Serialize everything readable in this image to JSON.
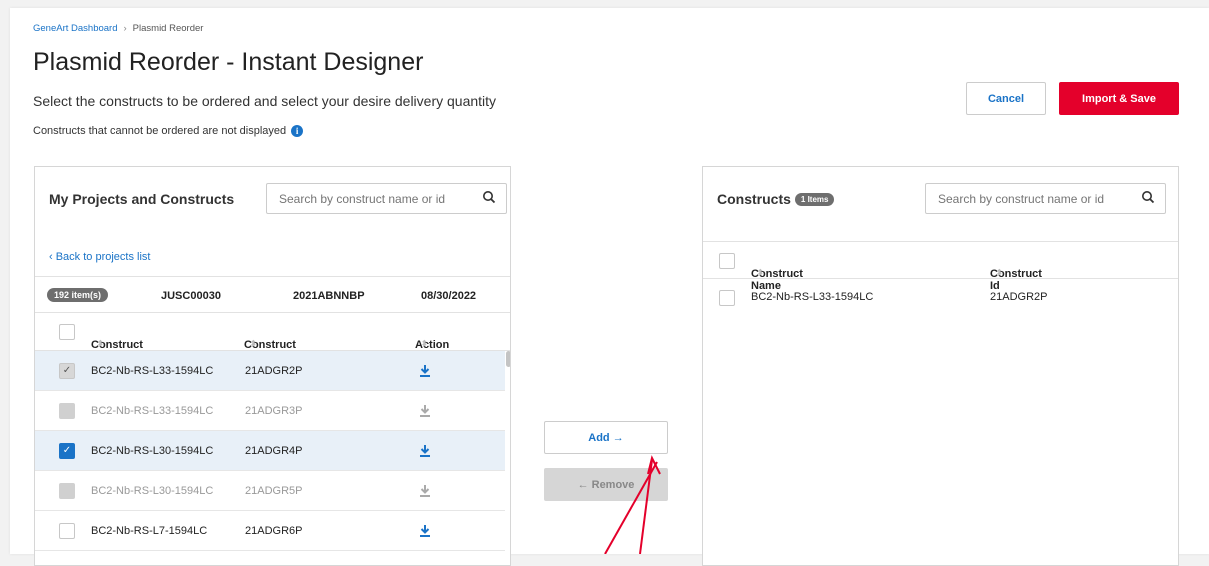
{
  "breadcrumb": {
    "home": "GeneArt Dashboard",
    "separator": "›",
    "current": "Plasmid Reorder"
  },
  "title": "Plasmid Reorder - Instant Designer",
  "subtitle": "Select the constructs to be ordered and select your desire delivery quantity",
  "note": "Constructs that cannot be ordered are not displayed",
  "info_glyph": "i",
  "actions": {
    "cancel": "Cancel",
    "import": "Import & Save"
  },
  "left_panel": {
    "title": "My Projects and Constructs",
    "search_placeholder": "Search by construct name or id",
    "back_link": "‹ Back to projects list",
    "project": {
      "count": "192 item(s)",
      "code": "JUSC00030",
      "id": "2021ABNNBP",
      "date": "08/30/2022"
    },
    "headers": {
      "name": "Construct Name",
      "id": "Construct Id",
      "action": "Action",
      "sort": "⬍"
    },
    "rows": [
      {
        "name": "BC2-Nb-RS-L33-1594LC",
        "id": "21ADGR2P",
        "state": "checked-grey"
      },
      {
        "name": "BC2-Nb-RS-L33-1594LC",
        "id": "21ADGR3P",
        "state": "disabled"
      },
      {
        "name": "BC2-Nb-RS-L30-1594LC",
        "id": "21ADGR4P",
        "state": "checked-blue"
      },
      {
        "name": "BC2-Nb-RS-L30-1594LC",
        "id": "21ADGR5P",
        "state": "disabled"
      },
      {
        "name": "BC2-Nb-RS-L7-1594LC",
        "id": "21ADGR6P",
        "state": "unchecked"
      }
    ]
  },
  "transfer": {
    "add": "Add →",
    "remove": "← Remove"
  },
  "right_panel": {
    "title": "Constructs",
    "badge": "1 Items",
    "search_placeholder": "Search by construct name or id",
    "headers": {
      "name": "Construct Name",
      "id": "Construct Id",
      "sort": "⬍"
    },
    "rows": [
      {
        "name": "BC2-Nb-RS-L33-1594LC",
        "id": "21ADGR2P"
      }
    ]
  },
  "check_glyph": "✓",
  "colors": {
    "accent": "#1a73c7",
    "primary_button": "#e4002b",
    "annotation_arrow": "#e4002b"
  }
}
